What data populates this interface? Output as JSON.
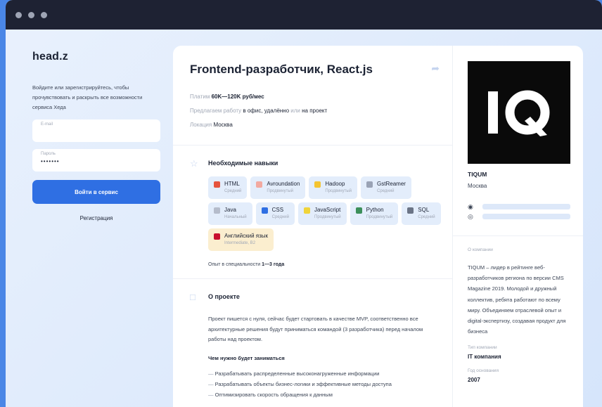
{
  "window": {
    "traffic_lights": 3
  },
  "sidebar": {
    "logo": "head.z",
    "intro": "Войдите или зарегистрируйтесь, чтобы прочувствовать и раскрыть все возможности сервиса Хеда",
    "email": {
      "label": "E-mail",
      "value": ""
    },
    "password": {
      "label": "Пароль",
      "value": "•••••••"
    },
    "login_button": "Войти в сервис",
    "register_link": "Регистрация"
  },
  "job": {
    "title": "Frontend-разработчик, React.js",
    "salary": {
      "label": "Платим",
      "value": "60K—120K руб/мес"
    },
    "work": {
      "label": "Предлагаем работу",
      "office": "в офис, удалённо",
      "or": "или",
      "project": "на проект"
    },
    "location": {
      "label": "Локация",
      "value": "Москва"
    }
  },
  "skills": {
    "title": "Необходимые навыки",
    "items": [
      {
        "name": "HTML",
        "level": "Средний",
        "color": "#e5533d",
        "type": "tech"
      },
      {
        "name": "Avroundation",
        "level": "Продвинутый",
        "color": "#f2a9a0",
        "type": "tech"
      },
      {
        "name": "Hadoop",
        "level": "Продвинутый",
        "color": "#f4c430",
        "type": "tech"
      },
      {
        "name": "GstReamer",
        "level": "Средний",
        "color": "#9aa3b5",
        "type": "tech"
      },
      {
        "name": "Java",
        "level": "Начальный",
        "color": "#b5bccb",
        "type": "tech"
      },
      {
        "name": "CSS",
        "level": "Средний",
        "color": "#2f6fe3",
        "type": "tech"
      },
      {
        "name": "JavaScript",
        "level": "Продвинутый",
        "color": "#f0d43a",
        "type": "tech"
      },
      {
        "name": "Python",
        "level": "Продвинутый",
        "color": "#3c8f5a",
        "type": "tech"
      },
      {
        "name": "SQL",
        "level": "Средний",
        "color": "#6b7486",
        "type": "tech"
      },
      {
        "name": "Английский язык",
        "level": "Intermediate, B2",
        "color": "#c8102e",
        "type": "lang"
      }
    ],
    "experience_label": "Опыт в специальности",
    "experience_value": "1—3 года"
  },
  "project": {
    "title": "О проекте",
    "text": "Проект пишется с нуля, сейчас будет стартовать в качестве MVP, соответственно все архитектурные решения будут приниматься командой (3 разработчика) перед началом работы над проектом.",
    "duties_title": "Чем нужно будет заниматься",
    "duties": [
      "Разрабатывать распределенные высоконагруженные информации",
      "Разрабатывать объекты бизнес-логики и эффективные методы доступа",
      "Оптимизировать скорость обращения к данным"
    ]
  },
  "company": {
    "logo_text": "IQ",
    "name": "TIQUM",
    "city": "Москва",
    "about_label": "О компании",
    "about": "TIQUM – лидер в рейтинге веб-разработчиков региона по версии CMS Magazine 2019. Молодой и дружный коллектив, ребята работают по всему миру. Объединяем отраслевой опыт и digital-экспертизу, создавая продукт для бизнеса",
    "type_label": "Тип компании",
    "type": "IT компания",
    "founded_label": "Год основания",
    "founded": "2007"
  },
  "colors": {
    "accent": "#2f6fe3",
    "dark": "#1e2233",
    "page_bg": "#4a86e6"
  }
}
